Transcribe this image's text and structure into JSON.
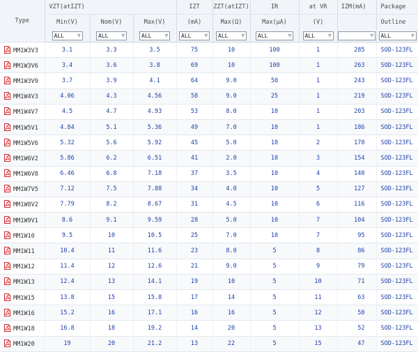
{
  "header": {
    "type_label": "Type",
    "vzt_group": "VZT(atIZT)",
    "min_label": "Min(V)",
    "nom_label": "Nom(V)",
    "max_label": "Max(V)",
    "izt_label": "IZT",
    "izt_unit": "(mA)",
    "zzt_label": "ZZT(atIZT)",
    "zzt_max": "Max(Ω)",
    "ir_label": "IR",
    "ir_max": "Max(μA)",
    "atvr_label": "at VR",
    "atvr_unit": "(V)",
    "izm_label": "IZM(mA)",
    "package_label": "Package",
    "package_sub": "Outline"
  },
  "filters": {
    "min": "ALL",
    "nom": "ALL",
    "max": "ALL",
    "izt": "ALL",
    "zzt": "ALL",
    "ir": "ALL",
    "atvr": "ALL",
    "izm": "",
    "package": "ALL"
  },
  "rows": [
    {
      "type": "MM1W3V3",
      "min": "3.1",
      "nom": "3.3",
      "max": "3.5",
      "izt": "75",
      "zzt": "10",
      "ir": "100",
      "vr": "1",
      "izm": "285",
      "pkg": "SOD-123FL"
    },
    {
      "type": "MM1W3V6",
      "min": "3.4",
      "nom": "3.6",
      "max": "3.8",
      "izt": "69",
      "zzt": "10",
      "ir": "100",
      "vr": "1",
      "izm": "263",
      "pkg": "SOD-123FL"
    },
    {
      "type": "MM1W3V9",
      "min": "3.7",
      "nom": "3.9",
      "max": "4.1",
      "izt": "64",
      "zzt": "9.0",
      "ir": "50",
      "vr": "1",
      "izm": "243",
      "pkg": "SOD-123FL"
    },
    {
      "type": "MM1W4V3",
      "min": "4.06",
      "nom": "4.3",
      "max": "4.56",
      "izt": "58",
      "zzt": "9.0",
      "ir": "25",
      "vr": "1",
      "izm": "219",
      "pkg": "SOD-123FL"
    },
    {
      "type": "MM1W4V7",
      "min": "4.5",
      "nom": "4.7",
      "max": "4.93",
      "izt": "53",
      "zzt": "8.0",
      "ir": "10",
      "vr": "1",
      "izm": "203",
      "pkg": "SOD-123FL"
    },
    {
      "type": "MM1W5V1",
      "min": "4.84",
      "nom": "5.1",
      "max": "5.36",
      "izt": "49",
      "zzt": "7.0",
      "ir": "10",
      "vr": "1",
      "izm": "186",
      "pkg": "SOD-123FL"
    },
    {
      "type": "MM1W5V6",
      "min": "5.32",
      "nom": "5.6",
      "max": "5.92",
      "izt": "45",
      "zzt": "5.0",
      "ir": "10",
      "vr": "2",
      "izm": "170",
      "pkg": "SOD-123FL"
    },
    {
      "type": "MM1W6V2",
      "min": "5.86",
      "nom": "6.2",
      "max": "6.51",
      "izt": "41",
      "zzt": "2.0",
      "ir": "10",
      "vr": "3",
      "izm": "154",
      "pkg": "SOD-123FL"
    },
    {
      "type": "MM1W6V8",
      "min": "6.46",
      "nom": "6.8",
      "max": "7.18",
      "izt": "37",
      "zzt": "3.5",
      "ir": "10",
      "vr": "4",
      "izm": "140",
      "pkg": "SOD-123FL"
    },
    {
      "type": "MM1W7V5",
      "min": "7.12",
      "nom": "7.5",
      "max": "7.88",
      "izt": "34",
      "zzt": "4.0",
      "ir": "10",
      "vr": "5",
      "izm": "127",
      "pkg": "SOD-123FL"
    },
    {
      "type": "MM1W8V2",
      "min": "7.79",
      "nom": "8.2",
      "max": "8.67",
      "izt": "31",
      "zzt": "4.5",
      "ir": "10",
      "vr": "6",
      "izm": "116",
      "pkg": "SOD-123FL"
    },
    {
      "type": "MM1W9V1",
      "min": "8.6",
      "nom": "9.1",
      "max": "9.59",
      "izt": "28",
      "zzt": "5.0",
      "ir": "10",
      "vr": "7",
      "izm": "104",
      "pkg": "SOD-123FL"
    },
    {
      "type": "MM1W10",
      "min": "9.5",
      "nom": "10",
      "max": "10.5",
      "izt": "25",
      "zzt": "7.0",
      "ir": "10",
      "vr": "7",
      "izm": "95",
      "pkg": "SOD-123FL"
    },
    {
      "type": "MM1W11",
      "min": "10.4",
      "nom": "11",
      "max": "11.6",
      "izt": "23",
      "zzt": "8.0",
      "ir": "5",
      "vr": "8",
      "izm": "86",
      "pkg": "SOD-123FL"
    },
    {
      "type": "MM1W12",
      "min": "11.4",
      "nom": "12",
      "max": "12.6",
      "izt": "21",
      "zzt": "9.0",
      "ir": "5",
      "vr": "9",
      "izm": "79",
      "pkg": "SOD-123FL"
    },
    {
      "type": "MM1W13",
      "min": "12.4",
      "nom": "13",
      "max": "14.1",
      "izt": "19",
      "zzt": "10",
      "ir": "5",
      "vr": "10",
      "izm": "71",
      "pkg": "SOD-123FL"
    },
    {
      "type": "MM1W15",
      "min": "13.8",
      "nom": "15",
      "max": "15.8",
      "izt": "17",
      "zzt": "14",
      "ir": "5",
      "vr": "11",
      "izm": "63",
      "pkg": "SOD-123FL"
    },
    {
      "type": "MM1W16",
      "min": "15.2",
      "nom": "16",
      "max": "17.1",
      "izt": "16",
      "zzt": "16",
      "ir": "5",
      "vr": "12",
      "izm": "58",
      "pkg": "SOD-123FL"
    },
    {
      "type": "MM1W18",
      "min": "16.8",
      "nom": "18",
      "max": "19.2",
      "izt": "14",
      "zzt": "20",
      "ir": "5",
      "vr": "13",
      "izm": "52",
      "pkg": "SOD-123FL"
    },
    {
      "type": "MM1W20",
      "min": "19",
      "nom": "20",
      "max": "21.2",
      "izt": "13",
      "zzt": "22",
      "ir": "5",
      "vr": "15",
      "izm": "47",
      "pkg": "SOD-123FL"
    }
  ],
  "icons": {
    "row_icon": "pdf-icon",
    "dropdown": "chevron-down-icon"
  },
  "colors": {
    "value_text": "#1c3fa8",
    "header_bg": "#f1f4f8",
    "pdf_red": "#d2262b"
  }
}
